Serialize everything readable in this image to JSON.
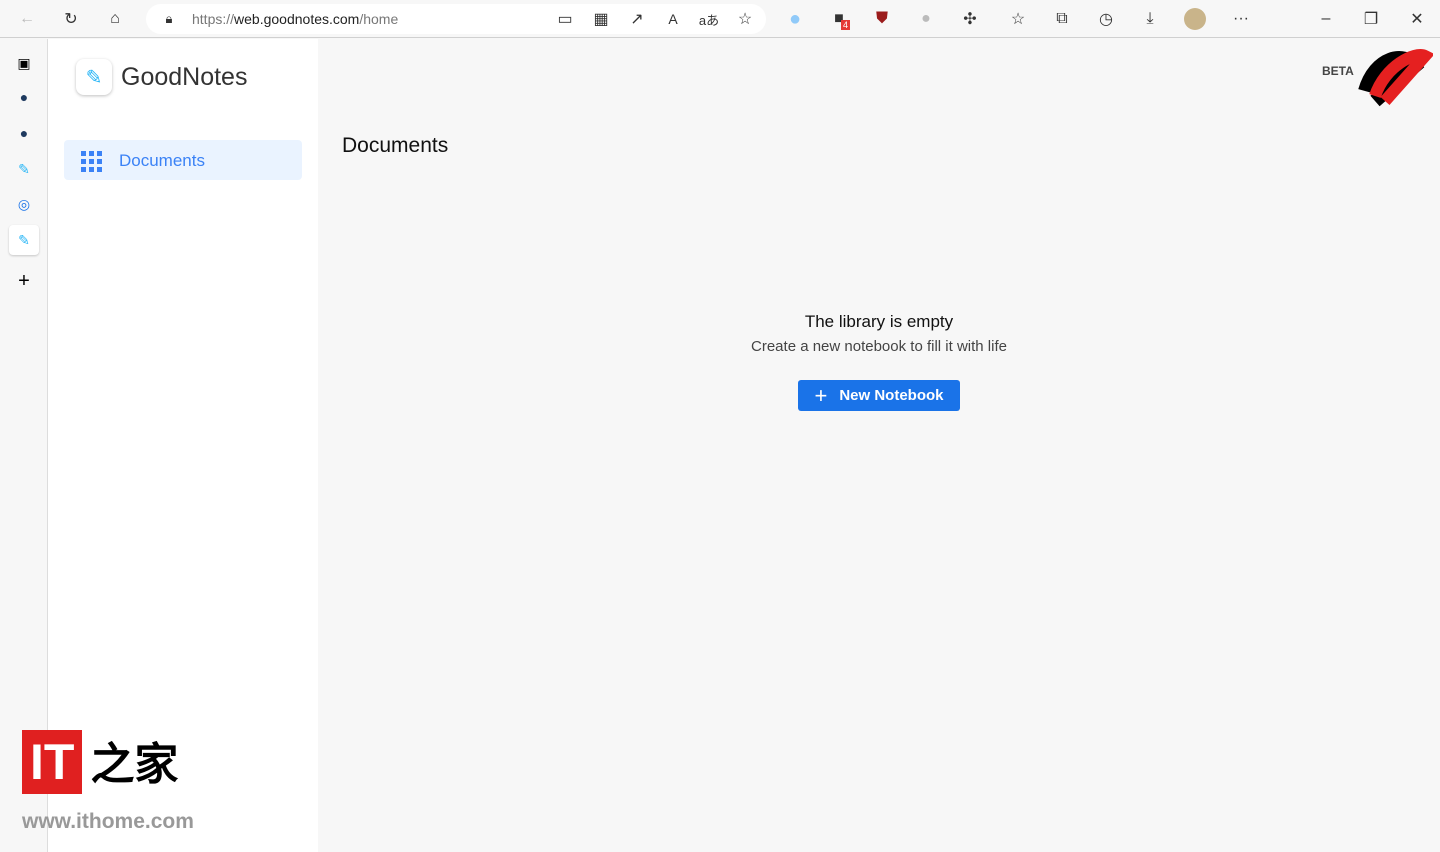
{
  "browser": {
    "url_prefix": "https://",
    "url_host": "web.goodnotes.com",
    "url_path": "/home",
    "badge_count": "4",
    "more": "···"
  },
  "app": {
    "name": "GoodNotes",
    "nav": [
      {
        "label": "Documents"
      }
    ],
    "beta": "BETA"
  },
  "main": {
    "title": "Documents",
    "empty_title": "The library is empty",
    "empty_subtitle": "Create a new notebook to fill it with life",
    "new_button": "New Notebook",
    "plus": "+"
  },
  "watermark": {
    "logo": "IT之家",
    "url": "www.ithome.com"
  }
}
